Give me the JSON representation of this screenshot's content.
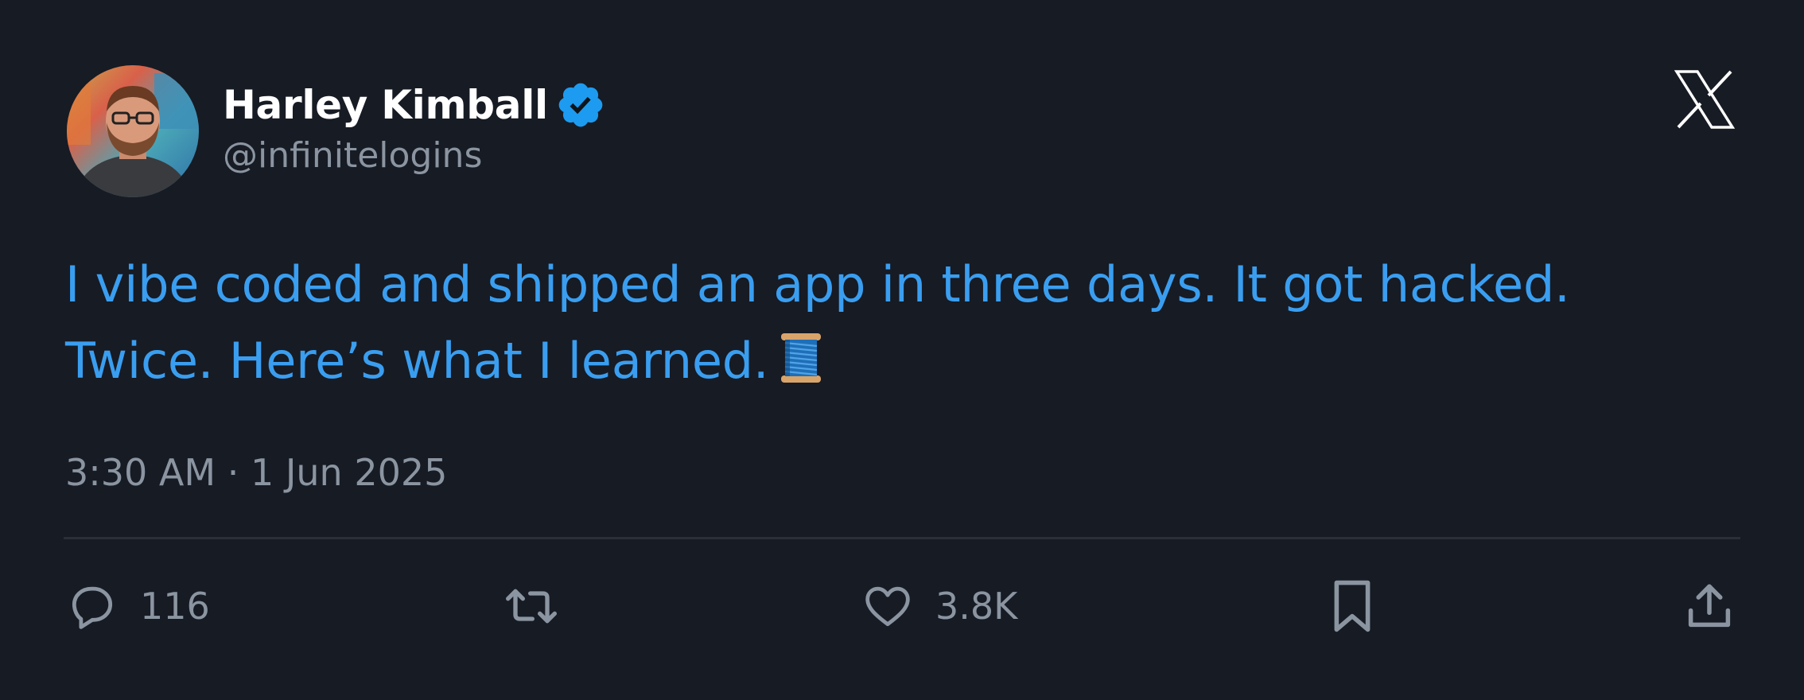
{
  "author": {
    "display_name": "Harley Kimball",
    "handle": "@infinitelogins",
    "verified": true
  },
  "tweet": {
    "text_line1": "I vibe coded and shipped an app in three days. It got hacked.",
    "text_line2": "Twice. Here’s what I learned.",
    "emoji": "spool-of-thread",
    "timestamp": "3:30 AM · 1 Jun 2025"
  },
  "actions": {
    "replies": "116",
    "retweets": "",
    "likes": "3.8K"
  },
  "icons": {
    "verified": "verified-badge-icon",
    "brand": "x-logo-icon",
    "reply": "reply-icon",
    "retweet": "retweet-icon",
    "like": "heart-icon",
    "bookmark": "bookmark-icon",
    "share": "share-icon"
  },
  "colors": {
    "background": "#171b24",
    "text_primary": "#ffffff",
    "text_secondary": "#8b95a1",
    "link_blue": "#3a9ef0",
    "verified_blue": "#1d9bf0",
    "divider": "#2a2f38"
  }
}
